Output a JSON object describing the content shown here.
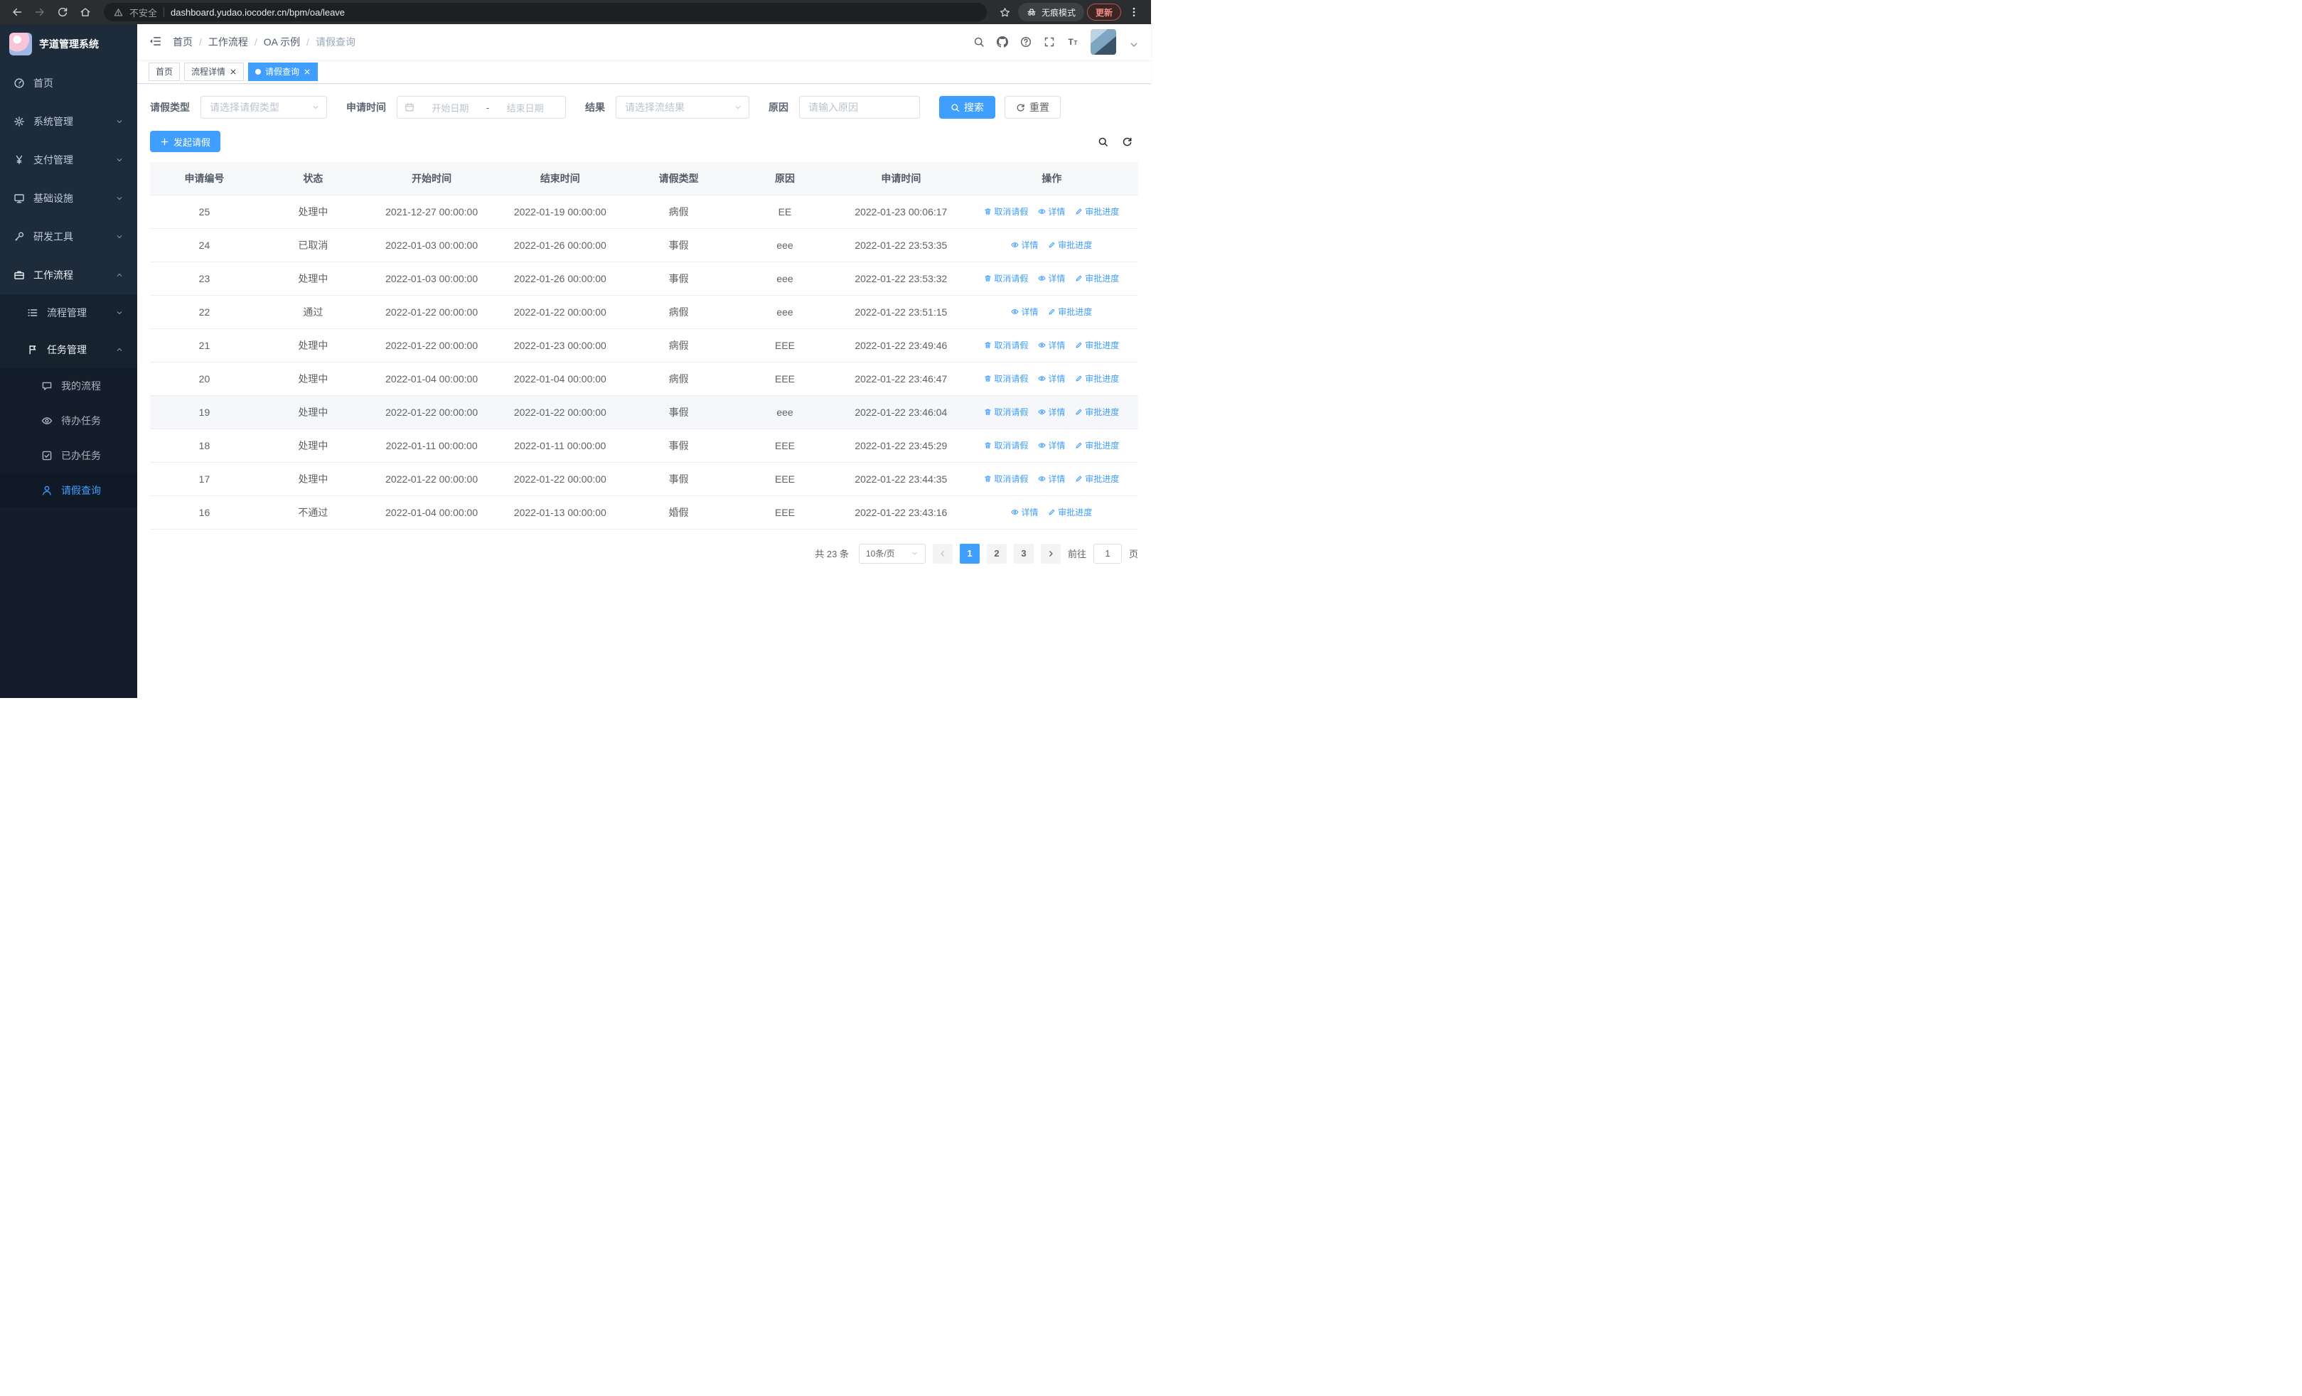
{
  "colors": {
    "accent": "#409eff",
    "sidebar_bg": "#1d2b3b",
    "danger": "#f28b82"
  },
  "icons": [
    "back-icon",
    "forward-icon",
    "reload-icon",
    "home-icon",
    "warning-icon",
    "star-icon",
    "incognito-icon",
    "more-menu-icon",
    "collapse-sidebar-icon",
    "search-icon",
    "github-icon",
    "help-icon",
    "fullscreen-icon",
    "font-size-icon",
    "chevron-down-icon",
    "chevron-up-icon",
    "calendar-icon",
    "plus-icon",
    "refresh-icon",
    "trash-icon",
    "eye-icon",
    "pen-icon",
    "close-icon"
  ],
  "browser": {
    "security_label": "不安全",
    "url": "dashboard.yudao.iocoder.cn/bpm/oa/leave",
    "incognito_label": "无痕模式",
    "update_label": "更新"
  },
  "sidebar": {
    "title": "芋道管理系统",
    "items": [
      {
        "label": "首页"
      },
      {
        "label": "系统管理"
      },
      {
        "label": "支付管理"
      },
      {
        "label": "基础设施"
      },
      {
        "label": "研发工具"
      },
      {
        "label": "工作流程"
      }
    ],
    "workflow_children": [
      {
        "label": "流程管理"
      },
      {
        "label": "任务管理"
      }
    ],
    "task_children": [
      {
        "label": "我的流程"
      },
      {
        "label": "待办任务"
      },
      {
        "label": "已办任务"
      },
      {
        "label": "请假查询"
      }
    ]
  },
  "breadcrumb": [
    "首页",
    "工作流程",
    "OA 示例",
    "请假查询"
  ],
  "tabs": [
    {
      "label": "首页"
    },
    {
      "label": "流程详情"
    },
    {
      "label": "请假查询"
    }
  ],
  "filters": {
    "leave_type_label": "请假类型",
    "leave_type_placeholder": "请选择请假类型",
    "apply_time_label": "申请时间",
    "start_placeholder": "开始日期",
    "separator": "-",
    "end_placeholder": "结束日期",
    "result_label": "结果",
    "result_placeholder": "请选择流结果",
    "reason_label": "原因",
    "reason_placeholder": "请输入原因",
    "search_label": "搜索",
    "reset_label": "重置"
  },
  "toolbar": {
    "create_label": "发起请假"
  },
  "table": {
    "columns": [
      "申请编号",
      "状态",
      "开始时间",
      "结束时间",
      "请假类型",
      "原因",
      "申请时间",
      "操作"
    ],
    "action_labels": {
      "cancel": "取消请假",
      "detail": "详情",
      "progress": "审批进度"
    },
    "rows": [
      {
        "id": "25",
        "status": "处理中",
        "start": "2021-12-27 00:00:00",
        "end": "2022-01-19 00:00:00",
        "type": "病假",
        "reason": "EE",
        "apply_time": "2022-01-23 00:06:17",
        "cancellable": true,
        "highlighted": false
      },
      {
        "id": "24",
        "status": "已取消",
        "start": "2022-01-03 00:00:00",
        "end": "2022-01-26 00:00:00",
        "type": "事假",
        "reason": "eee",
        "apply_time": "2022-01-22 23:53:35",
        "cancellable": false,
        "highlighted": false
      },
      {
        "id": "23",
        "status": "处理中",
        "start": "2022-01-03 00:00:00",
        "end": "2022-01-26 00:00:00",
        "type": "事假",
        "reason": "eee",
        "apply_time": "2022-01-22 23:53:32",
        "cancellable": true,
        "highlighted": false
      },
      {
        "id": "22",
        "status": "通过",
        "start": "2022-01-22 00:00:00",
        "end": "2022-01-22 00:00:00",
        "type": "病假",
        "reason": "eee",
        "apply_time": "2022-01-22 23:51:15",
        "cancellable": false,
        "highlighted": false
      },
      {
        "id": "21",
        "status": "处理中",
        "start": "2022-01-22 00:00:00",
        "end": "2022-01-23 00:00:00",
        "type": "病假",
        "reason": "EEE",
        "apply_time": "2022-01-22 23:49:46",
        "cancellable": true,
        "highlighted": false
      },
      {
        "id": "20",
        "status": "处理中",
        "start": "2022-01-04 00:00:00",
        "end": "2022-01-04 00:00:00",
        "type": "病假",
        "reason": "EEE",
        "apply_time": "2022-01-22 23:46:47",
        "cancellable": true,
        "highlighted": false
      },
      {
        "id": "19",
        "status": "处理中",
        "start": "2022-01-22 00:00:00",
        "end": "2022-01-22 00:00:00",
        "type": "事假",
        "reason": "eee",
        "apply_time": "2022-01-22 23:46:04",
        "cancellable": true,
        "highlighted": true
      },
      {
        "id": "18",
        "status": "处理中",
        "start": "2022-01-11 00:00:00",
        "end": "2022-01-11 00:00:00",
        "type": "事假",
        "reason": "EEE",
        "apply_time": "2022-01-22 23:45:29",
        "cancellable": true,
        "highlighted": false
      },
      {
        "id": "17",
        "status": "处理中",
        "start": "2022-01-22 00:00:00",
        "end": "2022-01-22 00:00:00",
        "type": "事假",
        "reason": "EEE",
        "apply_time": "2022-01-22 23:44:35",
        "cancellable": true,
        "highlighted": false
      },
      {
        "id": "16",
        "status": "不通过",
        "start": "2022-01-04 00:00:00",
        "end": "2022-01-13 00:00:00",
        "type": "婚假",
        "reason": "EEE",
        "apply_time": "2022-01-22 23:43:16",
        "cancellable": false,
        "highlighted": false
      }
    ]
  },
  "pagination": {
    "total_label": "共 23 条",
    "page_size_label": "10条/页",
    "pages": [
      "1",
      "2",
      "3"
    ],
    "active_page": "1",
    "goto_prefix": "前往",
    "goto_value": "1",
    "goto_suffix": "页"
  }
}
